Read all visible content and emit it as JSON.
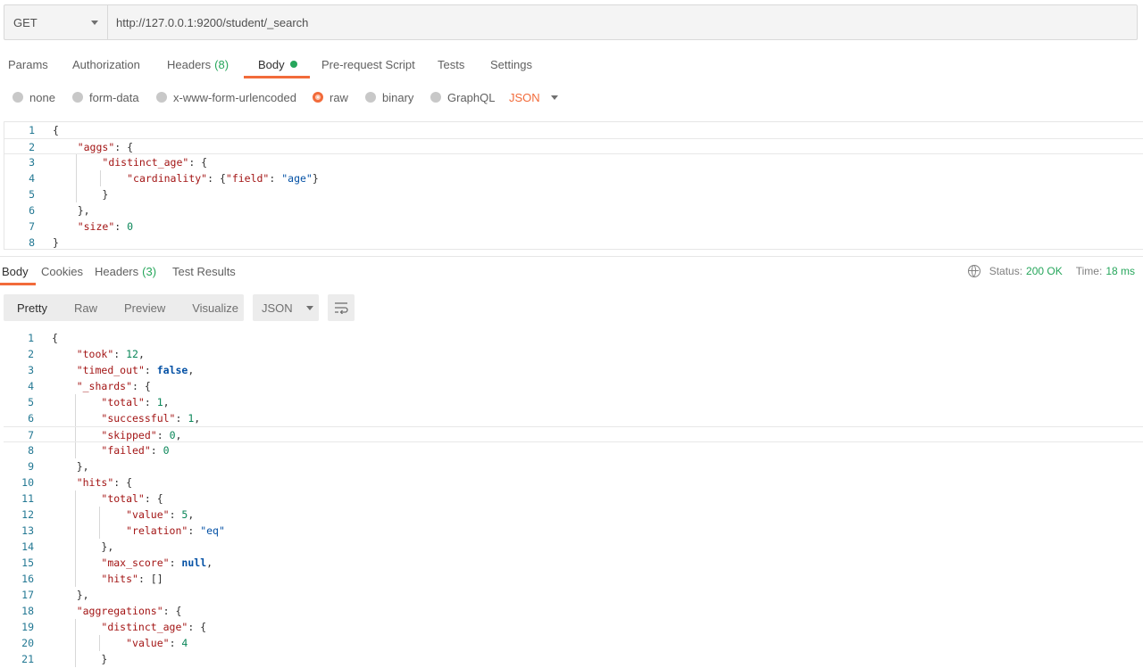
{
  "request": {
    "method": "GET",
    "url": "http://127.0.0.1:9200/student/_search"
  },
  "request_tabs": [
    {
      "label": "Params",
      "count": ""
    },
    {
      "label": "Authorization",
      "count": ""
    },
    {
      "label": "Headers",
      "count": "(8)"
    },
    {
      "label": "Body",
      "count": ""
    },
    {
      "label": "Pre-request Script",
      "count": ""
    },
    {
      "label": "Tests",
      "count": ""
    },
    {
      "label": "Settings",
      "count": ""
    }
  ],
  "body_types": [
    "none",
    "form-data",
    "x-www-form-urlencoded",
    "raw",
    "binary",
    "GraphQL"
  ],
  "body_language": "JSON",
  "request_body_lines": [
    "1",
    "2",
    "3",
    "4",
    "5",
    "6",
    "7",
    "8"
  ],
  "request_code": {
    "l1_open": "{",
    "l2_key": "\"aggs\"",
    "l2_rest": ": {",
    "l3_key": "\"distinct_age\"",
    "l3_rest": ": {",
    "l4_key": "\"cardinality\"",
    "l4_mid": ": {",
    "l4_key2": "\"field\"",
    "l4_colon": ": ",
    "l4_val": "\"age\"",
    "l4_close": "}",
    "l5": "}",
    "l6": "},",
    "l7_key": "\"size\"",
    "l7_colon": ": ",
    "l7_val": "0",
    "l8": "}"
  },
  "response_tabs": [
    {
      "label": "Body",
      "count": ""
    },
    {
      "label": "Cookies",
      "count": ""
    },
    {
      "label": "Headers",
      "count": "(3)"
    },
    {
      "label": "Test Results",
      "count": ""
    }
  ],
  "status": {
    "label": "Status:",
    "value": "200 OK",
    "time_label": "Time:",
    "time_value": "18 ms"
  },
  "view_modes": [
    "Pretty",
    "Raw",
    "Preview",
    "Visualize"
  ],
  "response_format": "JSON",
  "response_line_numbers": [
    "1",
    "2",
    "3",
    "4",
    "5",
    "6",
    "7",
    "8",
    "9",
    "10",
    "11",
    "12",
    "13",
    "14",
    "15",
    "16",
    "17",
    "18",
    "19",
    "20",
    "21"
  ],
  "response_code": {
    "r1": "{",
    "r2_key": "\"took\"",
    "r2_val": "12",
    "r3_key": "\"timed_out\"",
    "r3_val": "false",
    "r4_key": "\"_shards\"",
    "r4_rest": ": {",
    "r5_key": "\"total\"",
    "r5_val": "1",
    "r6_key": "\"successful\"",
    "r6_val": "1",
    "r7_key": "\"skipped\"",
    "r7_val": "0",
    "r8_key": "\"failed\"",
    "r8_val": "0",
    "r9": "},",
    "r10_key": "\"hits\"",
    "r10_rest": ": {",
    "r11_key": "\"total\"",
    "r11_rest": ": {",
    "r12_key": "\"value\"",
    "r12_val": "5",
    "r13_key": "\"relation\"",
    "r13_val": "\"eq\"",
    "r14": "},",
    "r15_key": "\"max_score\"",
    "r15_val": "null",
    "r16_key": "\"hits\"",
    "r16_val": "[]",
    "r17": "},",
    "r18_key": "\"aggregations\"",
    "r18_rest": ": {",
    "r19_key": "\"distinct_age\"",
    "r19_rest": ": {",
    "r20_key": "\"value\"",
    "r20_val": "4",
    "r21": "}"
  }
}
